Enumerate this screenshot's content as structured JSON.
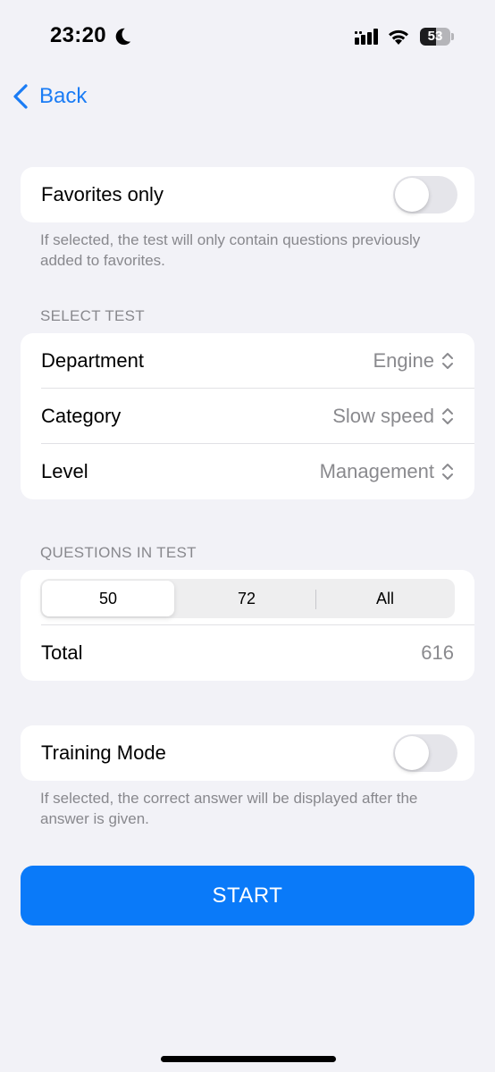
{
  "status_bar": {
    "time": "23:20",
    "battery_level": "53",
    "icons": [
      "moon-icon",
      "cellular-signal-icon",
      "wifi-icon",
      "battery-icon"
    ]
  },
  "nav": {
    "back_label": "Back",
    "back_icon": "chevron-left-icon"
  },
  "favorites": {
    "label": "Favorites only",
    "enabled": false,
    "footnote": "If selected, the test will only contain questions previously added to favorites."
  },
  "select_test": {
    "header": "SELECT TEST",
    "rows": [
      {
        "label": "Department",
        "value": "Engine"
      },
      {
        "label": "Category",
        "value": "Slow speed"
      },
      {
        "label": "Level",
        "value": "Management"
      }
    ]
  },
  "questions": {
    "header": "QUESTIONS IN TEST",
    "segments": [
      "50",
      "72",
      "All"
    ],
    "selected_segment": "50",
    "total_label": "Total",
    "total_value": "616"
  },
  "training": {
    "label": "Training Mode",
    "enabled": false,
    "footnote": "If selected, the correct answer will be displayed after the answer is given."
  },
  "start_label": "START",
  "colors": {
    "accent": "#0a7af9",
    "background": "#f2f2f7",
    "secondary_text": "#88888d"
  }
}
